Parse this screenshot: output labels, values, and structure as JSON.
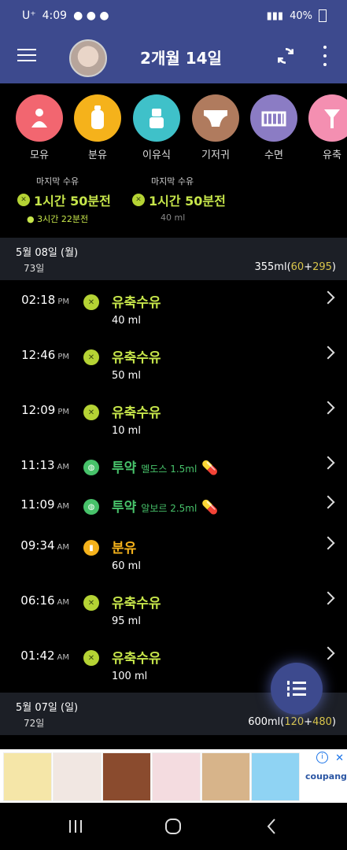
{
  "status_bar": {
    "carrier": "U⁺",
    "time": "4:09",
    "battery": "40%"
  },
  "app_bar": {
    "title": "2개월 14일"
  },
  "categories": [
    {
      "label": "모유",
      "icon": "breastfeeding-icon",
      "color": "#f26670"
    },
    {
      "label": "분유",
      "icon": "baby-bottle-icon",
      "color": "#f5b21b"
    },
    {
      "label": "이유식",
      "icon": "baby-food-icon",
      "color": "#3fc1c9"
    },
    {
      "label": "기저귀",
      "icon": "diaper-icon",
      "color": "#b07b5e"
    },
    {
      "label": "수면",
      "icon": "crib-icon",
      "color": "#8b7cc4"
    },
    {
      "label": "유축",
      "icon": "breast-pump-icon",
      "color": "#f48fb1"
    }
  ],
  "last_feed": [
    {
      "title": "마지막 수유",
      "value": "1시간 50분전",
      "sub": "3시간 22분전"
    },
    {
      "title": "마지막 수유",
      "value": "1시간 50분전",
      "sub": "40 ml"
    }
  ],
  "days": [
    {
      "date": "5월 08일 (월)",
      "age": "73일",
      "total": "355ml",
      "open": "(",
      "a": "60",
      "plus": "+",
      "b": "295",
      "close": ")",
      "entries": [
        {
          "time": "02:18",
          "ampm": "PM",
          "name": "유축수유",
          "detail": "40 ml",
          "kind": "pump"
        },
        {
          "time": "12:46",
          "ampm": "PM",
          "name": "유축수유",
          "detail": "50 ml",
          "kind": "pump"
        },
        {
          "time": "12:09",
          "ampm": "PM",
          "name": "유축수유",
          "detail": "10 ml",
          "kind": "pump"
        },
        {
          "time": "11:13",
          "ampm": "AM",
          "name": "투약",
          "inline": "멜도스 1.5ml",
          "kind": "med"
        },
        {
          "time": "11:09",
          "ampm": "AM",
          "name": "투약",
          "inline": "알보르 2.5ml",
          "kind": "med"
        },
        {
          "time": "09:34",
          "ampm": "AM",
          "name": "분유",
          "detail": "60 ml",
          "kind": "formula"
        },
        {
          "time": "06:16",
          "ampm": "AM",
          "name": "유축수유",
          "detail": "95 ml",
          "kind": "pump"
        },
        {
          "time": "01:42",
          "ampm": "AM",
          "name": "유축수유",
          "detail": "100 ml",
          "kind": "pump"
        }
      ]
    },
    {
      "date": "5월 07일 (일)",
      "age": "72일",
      "total": "600ml",
      "open": "(",
      "a": "120",
      "plus": "+",
      "b": "480",
      "close": ")"
    }
  ],
  "ad": {
    "brand": "coupang"
  },
  "colors": {
    "pump": "#c6e54a",
    "med": "#47c26a",
    "formula": "#f5b21b",
    "accent": "#3d4a8e"
  }
}
